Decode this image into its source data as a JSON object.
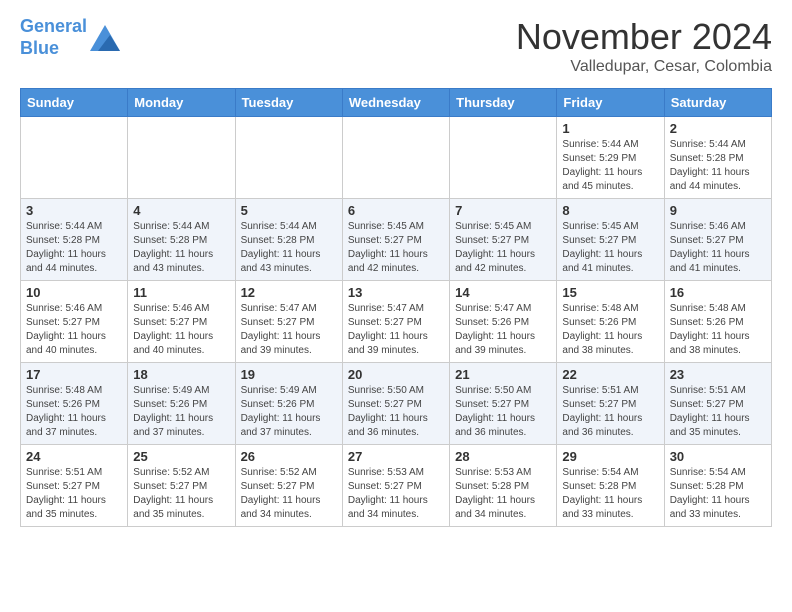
{
  "header": {
    "logo_line1": "General",
    "logo_line2": "Blue",
    "month_title": "November 2024",
    "location": "Valledupar, Cesar, Colombia"
  },
  "days_of_week": [
    "Sunday",
    "Monday",
    "Tuesday",
    "Wednesday",
    "Thursday",
    "Friday",
    "Saturday"
  ],
  "weeks": [
    [
      {
        "day": "",
        "info": ""
      },
      {
        "day": "",
        "info": ""
      },
      {
        "day": "",
        "info": ""
      },
      {
        "day": "",
        "info": ""
      },
      {
        "day": "",
        "info": ""
      },
      {
        "day": "1",
        "info": "Sunrise: 5:44 AM\nSunset: 5:29 PM\nDaylight: 11 hours and 45 minutes."
      },
      {
        "day": "2",
        "info": "Sunrise: 5:44 AM\nSunset: 5:28 PM\nDaylight: 11 hours and 44 minutes."
      }
    ],
    [
      {
        "day": "3",
        "info": "Sunrise: 5:44 AM\nSunset: 5:28 PM\nDaylight: 11 hours and 44 minutes."
      },
      {
        "day": "4",
        "info": "Sunrise: 5:44 AM\nSunset: 5:28 PM\nDaylight: 11 hours and 43 minutes."
      },
      {
        "day": "5",
        "info": "Sunrise: 5:44 AM\nSunset: 5:28 PM\nDaylight: 11 hours and 43 minutes."
      },
      {
        "day": "6",
        "info": "Sunrise: 5:45 AM\nSunset: 5:27 PM\nDaylight: 11 hours and 42 minutes."
      },
      {
        "day": "7",
        "info": "Sunrise: 5:45 AM\nSunset: 5:27 PM\nDaylight: 11 hours and 42 minutes."
      },
      {
        "day": "8",
        "info": "Sunrise: 5:45 AM\nSunset: 5:27 PM\nDaylight: 11 hours and 41 minutes."
      },
      {
        "day": "9",
        "info": "Sunrise: 5:46 AM\nSunset: 5:27 PM\nDaylight: 11 hours and 41 minutes."
      }
    ],
    [
      {
        "day": "10",
        "info": "Sunrise: 5:46 AM\nSunset: 5:27 PM\nDaylight: 11 hours and 40 minutes."
      },
      {
        "day": "11",
        "info": "Sunrise: 5:46 AM\nSunset: 5:27 PM\nDaylight: 11 hours and 40 minutes."
      },
      {
        "day": "12",
        "info": "Sunrise: 5:47 AM\nSunset: 5:27 PM\nDaylight: 11 hours and 39 minutes."
      },
      {
        "day": "13",
        "info": "Sunrise: 5:47 AM\nSunset: 5:27 PM\nDaylight: 11 hours and 39 minutes."
      },
      {
        "day": "14",
        "info": "Sunrise: 5:47 AM\nSunset: 5:26 PM\nDaylight: 11 hours and 39 minutes."
      },
      {
        "day": "15",
        "info": "Sunrise: 5:48 AM\nSunset: 5:26 PM\nDaylight: 11 hours and 38 minutes."
      },
      {
        "day": "16",
        "info": "Sunrise: 5:48 AM\nSunset: 5:26 PM\nDaylight: 11 hours and 38 minutes."
      }
    ],
    [
      {
        "day": "17",
        "info": "Sunrise: 5:48 AM\nSunset: 5:26 PM\nDaylight: 11 hours and 37 minutes."
      },
      {
        "day": "18",
        "info": "Sunrise: 5:49 AM\nSunset: 5:26 PM\nDaylight: 11 hours and 37 minutes."
      },
      {
        "day": "19",
        "info": "Sunrise: 5:49 AM\nSunset: 5:26 PM\nDaylight: 11 hours and 37 minutes."
      },
      {
        "day": "20",
        "info": "Sunrise: 5:50 AM\nSunset: 5:27 PM\nDaylight: 11 hours and 36 minutes."
      },
      {
        "day": "21",
        "info": "Sunrise: 5:50 AM\nSunset: 5:27 PM\nDaylight: 11 hours and 36 minutes."
      },
      {
        "day": "22",
        "info": "Sunrise: 5:51 AM\nSunset: 5:27 PM\nDaylight: 11 hours and 36 minutes."
      },
      {
        "day": "23",
        "info": "Sunrise: 5:51 AM\nSunset: 5:27 PM\nDaylight: 11 hours and 35 minutes."
      }
    ],
    [
      {
        "day": "24",
        "info": "Sunrise: 5:51 AM\nSunset: 5:27 PM\nDaylight: 11 hours and 35 minutes."
      },
      {
        "day": "25",
        "info": "Sunrise: 5:52 AM\nSunset: 5:27 PM\nDaylight: 11 hours and 35 minutes."
      },
      {
        "day": "26",
        "info": "Sunrise: 5:52 AM\nSunset: 5:27 PM\nDaylight: 11 hours and 34 minutes."
      },
      {
        "day": "27",
        "info": "Sunrise: 5:53 AM\nSunset: 5:27 PM\nDaylight: 11 hours and 34 minutes."
      },
      {
        "day": "28",
        "info": "Sunrise: 5:53 AM\nSunset: 5:28 PM\nDaylight: 11 hours and 34 minutes."
      },
      {
        "day": "29",
        "info": "Sunrise: 5:54 AM\nSunset: 5:28 PM\nDaylight: 11 hours and 33 minutes."
      },
      {
        "day": "30",
        "info": "Sunrise: 5:54 AM\nSunset: 5:28 PM\nDaylight: 11 hours and 33 minutes."
      }
    ]
  ]
}
